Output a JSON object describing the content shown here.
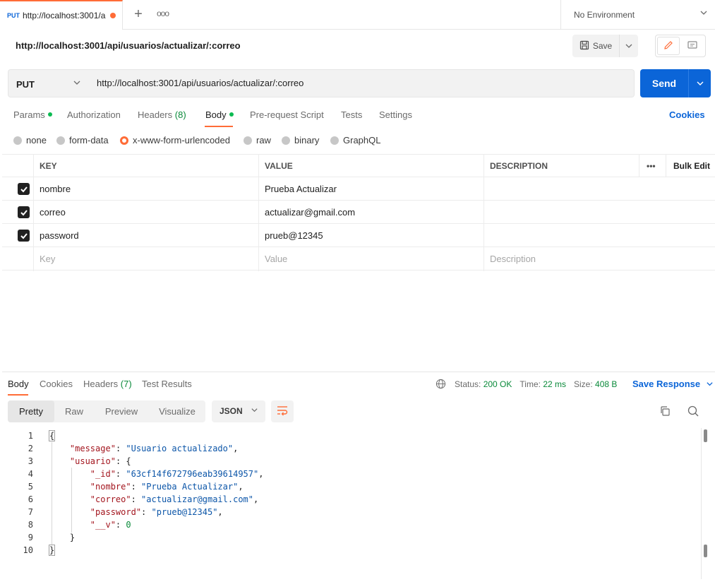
{
  "tabs": [
    {
      "method": "PUT",
      "url": "http://localhost:3001/a",
      "unsaved": true
    }
  ],
  "environment": {
    "label": "No Environment"
  },
  "request": {
    "title": "http://localhost:3001/api/usuarios/actualizar/:correo",
    "method": "PUT",
    "url": "http://localhost:3001/api/usuarios/actualizar/:correo",
    "save_label": "Save",
    "send_label": "Send"
  },
  "request_tabs": [
    {
      "label": "Params",
      "dot": true
    },
    {
      "label": "Authorization"
    },
    {
      "label": "Headers",
      "count": "(8)"
    },
    {
      "label": "Body",
      "dot": true,
      "active": true
    },
    {
      "label": "Pre-request Script"
    },
    {
      "label": "Tests"
    },
    {
      "label": "Settings"
    }
  ],
  "cookies_label": "Cookies",
  "body_types": [
    {
      "label": "none"
    },
    {
      "label": "form-data"
    },
    {
      "label": "x-www-form-urlencoded",
      "selected": true
    },
    {
      "label": "raw"
    },
    {
      "label": "binary"
    },
    {
      "label": "GraphQL"
    }
  ],
  "kv_table": {
    "headers": {
      "key": "KEY",
      "value": "VALUE",
      "description": "DESCRIPTION",
      "more": "•••",
      "bulk_edit": "Bulk Edit"
    },
    "rows": [
      {
        "key": "nombre",
        "value": "Prueba Actualizar",
        "description": "",
        "checked": true
      },
      {
        "key": "correo",
        "value": "actualizar@gmail.com",
        "description": "",
        "checked": true
      },
      {
        "key": "password",
        "value": "prueb@12345",
        "description": "",
        "checked": true
      }
    ],
    "placeholders": {
      "key": "Key",
      "value": "Value",
      "description": "Description"
    }
  },
  "response": {
    "tabs": [
      {
        "label": "Body",
        "active": true
      },
      {
        "label": "Cookies"
      },
      {
        "label": "Headers",
        "count": "(7)"
      },
      {
        "label": "Test Results"
      }
    ],
    "status_label": "Status:",
    "status_value": "200 OK",
    "time_label": "Time:",
    "time_value": "22 ms",
    "size_label": "Size:",
    "size_value": "408 B",
    "save_response": "Save Response",
    "view_modes": [
      "Pretty",
      "Raw",
      "Preview",
      "Visualize"
    ],
    "format": "JSON",
    "code_lines": [
      {
        "n": "1"
      },
      {
        "n": "2"
      },
      {
        "n": "3"
      },
      {
        "n": "4"
      },
      {
        "n": "5"
      },
      {
        "n": "6"
      },
      {
        "n": "7"
      },
      {
        "n": "8"
      },
      {
        "n": "9"
      },
      {
        "n": "10"
      }
    ],
    "json": {
      "message_key": "\"message\"",
      "message_val": "\"Usuario actualizado\"",
      "usuario_key": "\"usuario\"",
      "id_key": "\"_id\"",
      "id_val": "\"63cf14f672796eab39614957\"",
      "nombre_key": "\"nombre\"",
      "nombre_val": "\"Prueba Actualizar\"",
      "correo_key": "\"correo\"",
      "correo_val": "\"actualizar@gmail.com\"",
      "password_key": "\"password\"",
      "password_val": "\"prueb@12345\"",
      "v_key": "\"__v\"",
      "v_val": "0"
    }
  },
  "colors": {
    "accent": "#ff6c37",
    "primary": "#0b65d8",
    "success": "#0a8a3a"
  }
}
